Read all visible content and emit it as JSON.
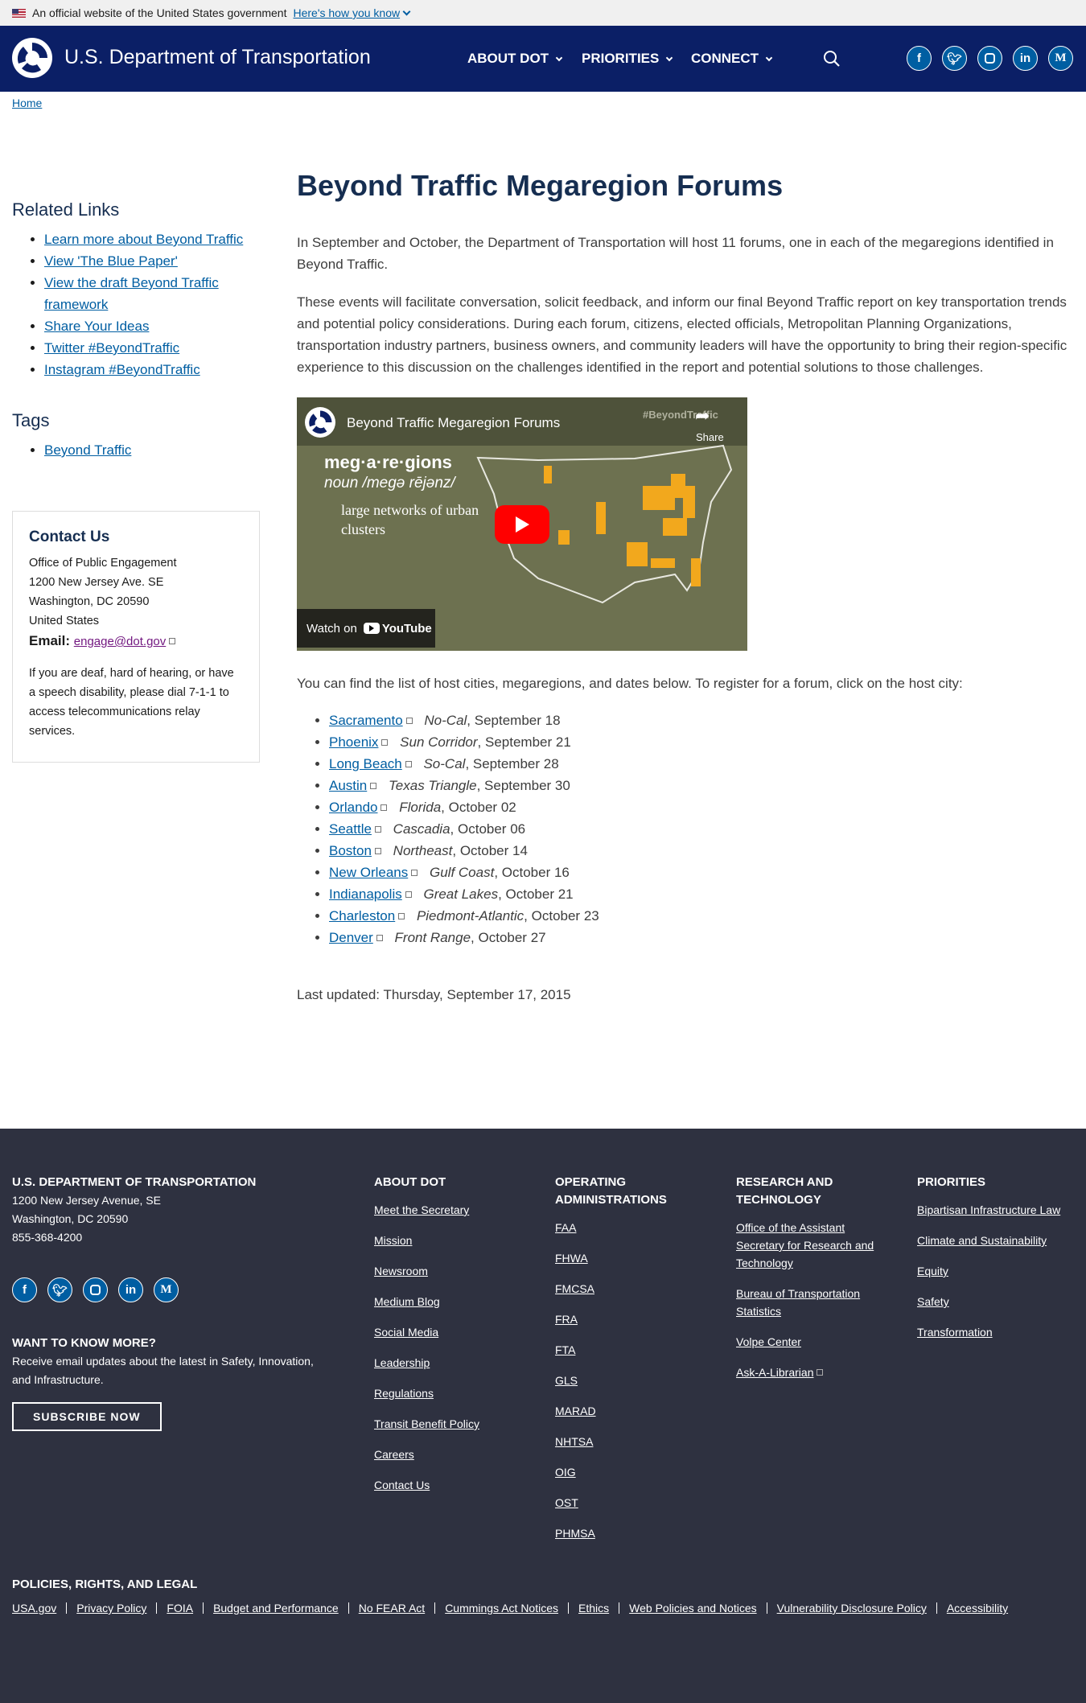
{
  "banner": {
    "text": "An official website of the United States government",
    "link": "Here's how you know"
  },
  "header": {
    "site_name": "U.S. Department of Transportation",
    "nav": [
      "ABOUT DOT",
      "PRIORITIES",
      "CONNECT"
    ],
    "social": [
      "f",
      "t",
      "ig",
      "in",
      "M"
    ]
  },
  "breadcrumb": {
    "home": "Home"
  },
  "sidebar": {
    "related_title": "Related Links",
    "related_links": [
      "Learn more about Beyond Traffic",
      "View 'The Blue Paper'",
      "View the draft Beyond Traffic framework",
      "Share Your Ideas",
      "Twitter #BeyondTraffic",
      "Instagram #BeyondTraffic"
    ],
    "tags_title": "Tags",
    "tags": [
      "Beyond Traffic"
    ]
  },
  "contact": {
    "title": "Contact Us",
    "office": "Office of Public Engagement",
    "address1": "1200 New Jersey Ave. SE",
    "address2": "Washington, DC 20590",
    "country": "United States",
    "email_label": "Email:",
    "email": "engage@dot.gov",
    "note": "If you are deaf, hard of hearing, or have a speech disability, please dial 7-1-1 to access telecommunications relay services."
  },
  "main": {
    "title": "Beyond Traffic Megaregion Forums",
    "para1": "In September and October, the Department of Transportation will host 11 forums, one in each of the megaregions identified in Beyond Traffic.",
    "para2": "These events will facilitate conversation, solicit feedback, and inform our final Beyond Traffic report on key transportation trends and potential policy considerations. During each forum, citizens, elected officials, Metropolitan Planning Organizations, transportation industry partners, business owners, and community leaders will have the opportunity to bring their region-specific experience to this discussion on the challenges identified in the report and potential solutions to those challenges.",
    "video": {
      "title": "Beyond Traffic Megaregion Forums",
      "hashtag": "#BeyondTraffic",
      "share": "Share",
      "heading": "meg·a·re·gions",
      "pron": "noun /megə rējənz/",
      "def": "large networks of urban clusters",
      "watch": "Watch on",
      "yt": "YouTube"
    },
    "intro": "You can find the list of host cities, megaregions, and dates below. To register for a forum, click on the host city:",
    "cities": [
      {
        "city": "Sacramento",
        "region": "No-Cal",
        "date": "September 18"
      },
      {
        "city": "Phoenix",
        "region": "Sun Corridor",
        "date": "September 21"
      },
      {
        "city": "Long Beach",
        "region": "So-Cal",
        "date": "September 28"
      },
      {
        "city": "Austin",
        "region": "Texas Triangle",
        "date": "September 30"
      },
      {
        "city": "Orlando",
        "region": "Florida",
        "date": "October 02"
      },
      {
        "city": "Seattle",
        "region": "Cascadia",
        "date": "October 06"
      },
      {
        "city": "Boston",
        "region": "Northeast",
        "date": "October 14"
      },
      {
        "city": "New Orleans",
        "region": "Gulf Coast",
        "date": "October 16"
      },
      {
        "city": "Indianapolis",
        "region": "Great Lakes",
        "date": "October 21"
      },
      {
        "city": "Charleston",
        "region": "Piedmont-Atlantic",
        "date": "October 23"
      },
      {
        "city": "Denver",
        "region": "Front Range",
        "date": "October 27"
      }
    ],
    "updated": "Last updated: Thursday, September 17, 2015"
  },
  "footer": {
    "dept_title": "U.S. DEPARTMENT OF TRANSPORTATION",
    "addr1": "1200 New Jersey Avenue, SE",
    "addr2": "Washington, DC 20590",
    "phone": "855-368-4200",
    "want_title": "WANT TO KNOW MORE?",
    "want_text": "Receive email updates about the latest in Safety, Innovation, and Infrastructure.",
    "subscribe": "SUBSCRIBE NOW",
    "about_title": "ABOUT DOT",
    "about_links": [
      "Meet the Secretary",
      "Mission",
      "Newsroom",
      "Medium Blog",
      "Social Media",
      "Leadership",
      "Regulations",
      "Transit Benefit Policy",
      "Careers",
      "Contact Us"
    ],
    "ops_title": "OPERATING ADMINISTRATIONS",
    "ops_links": [
      "FAA",
      "FHWA",
      "FMCSA",
      "FRA",
      "FTA",
      "GLS",
      "MARAD",
      "NHTSA",
      "OIG",
      "OST",
      "PHMSA"
    ],
    "research_title": "RESEARCH AND TECHNOLOGY",
    "research_links": [
      "Office of the Assistant Secretary for Research and Technology",
      "Bureau of Transportation Statistics",
      "Volpe Center",
      "Ask-A-Librarian"
    ],
    "priorities_title": "PRIORITIES",
    "priorities_links": [
      "Bipartisan Infrastructure Law",
      "Climate and Sustainability",
      "Equity",
      "Safety",
      "Transformation"
    ],
    "legal_title": "POLICIES, RIGHTS, AND LEGAL",
    "legal_links": [
      "USA.gov",
      "Privacy Policy",
      "FOIA",
      "Budget and Performance",
      "No FEAR Act",
      "Cummings Act Notices",
      "Ethics",
      "Web Policies and Notices",
      "Vulnerability Disclosure Policy",
      "Accessibility"
    ]
  },
  "colors": {
    "header_bg": "#0b1f66",
    "link": "#005ea2",
    "heading": "#162e51",
    "footer_bg": "#2e3140"
  }
}
